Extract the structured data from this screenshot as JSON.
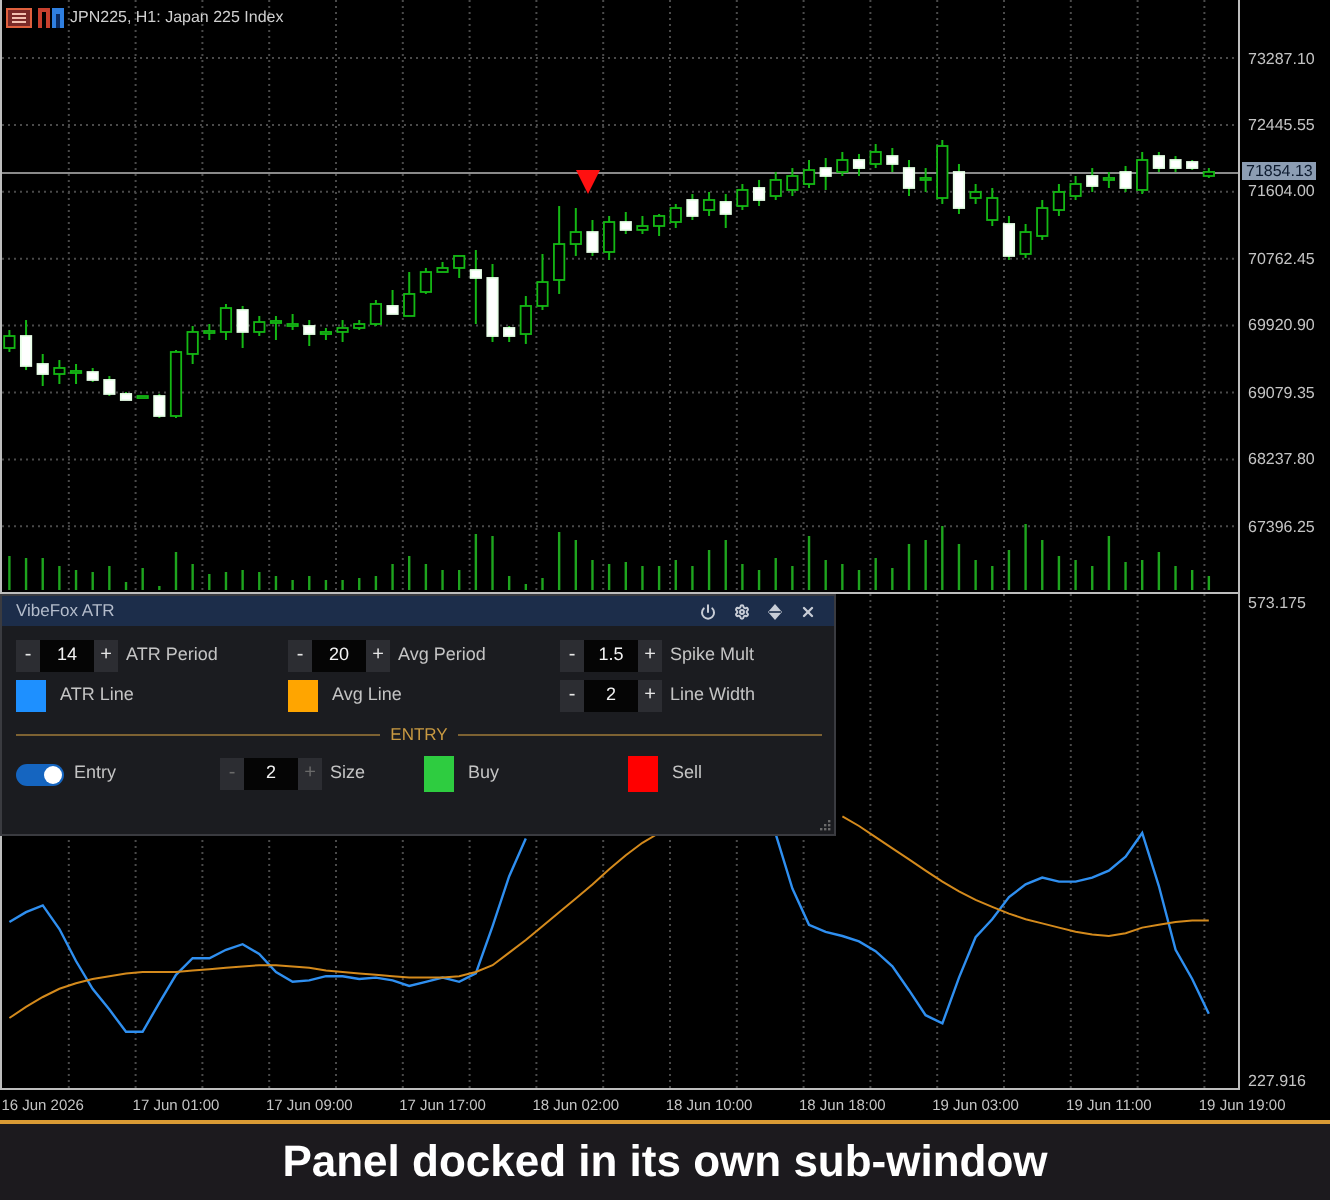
{
  "chart": {
    "title": "JPN225, H1: Japan 225 Index",
    "chart_data": {
      "type": "candlestick",
      "categories": [
        null,
        null,
        null,
        null,
        null,
        null,
        null,
        null,
        null,
        null,
        null,
        null,
        null,
        null,
        null,
        null,
        null,
        null,
        null,
        null,
        null,
        null,
        null,
        null,
        null,
        null,
        null,
        null,
        null,
        null,
        null,
        null,
        null,
        null,
        null,
        null,
        null,
        null,
        null,
        null,
        null,
        null,
        null,
        null,
        null,
        null,
        null,
        null,
        null,
        null,
        null,
        null,
        null,
        null,
        null,
        null,
        null,
        null,
        null,
        null,
        null,
        null,
        null,
        null,
        null,
        null,
        null,
        null,
        null,
        null,
        null,
        null,
        null
      ],
      "ohlc": [
        [
          69639,
          69866,
          69589,
          69790
        ],
        [
          69790,
          69991,
          69362,
          69413
        ],
        [
          69438,
          69564,
          69161,
          69312
        ],
        [
          69312,
          69488,
          69186,
          69388
        ],
        [
          69325,
          69438,
          69186,
          69350
        ],
        [
          69337,
          69388,
          69212,
          69237
        ],
        [
          69237,
          69287,
          69035,
          69061
        ],
        [
          69061,
          69086,
          68985,
          68985
        ],
        [
          69010,
          69035,
          69010,
          69035
        ],
        [
          69035,
          69061,
          68759,
          68784
        ],
        [
          68784,
          69614,
          68759,
          69589
        ],
        [
          69564,
          69916,
          69438,
          69841
        ],
        [
          69828,
          69941,
          69740,
          69853
        ],
        [
          69841,
          70193,
          69740,
          70142
        ],
        [
          70117,
          70168,
          69639,
          69841
        ],
        [
          69841,
          70042,
          69790,
          69966
        ],
        [
          69954,
          70042,
          69740,
          69979
        ],
        [
          69916,
          70067,
          69866,
          69941
        ],
        [
          69916,
          69991,
          69664,
          69815
        ],
        [
          69815,
          69891,
          69740,
          69841
        ],
        [
          69841,
          69991,
          69715,
          69891
        ],
        [
          69891,
          69991,
          69866,
          69941
        ],
        [
          69941,
          70243,
          69916,
          70193
        ],
        [
          70168,
          70369,
          70067,
          70067
        ],
        [
          70042,
          70595,
          70042,
          70319
        ],
        [
          70344,
          70646,
          70319,
          70595
        ],
        [
          70595,
          70721,
          70595,
          70646
        ],
        [
          70646,
          70797,
          70520,
          70797
        ],
        [
          70620,
          70872,
          69941,
          70520
        ],
        [
          70520,
          70696,
          69715,
          69790
        ],
        [
          69891,
          69916,
          69715,
          69790
        ],
        [
          69815,
          70293,
          69690,
          70168
        ],
        [
          70168,
          70822,
          70117,
          70469
        ],
        [
          70495,
          71425,
          70319,
          70947
        ],
        [
          70947,
          71400,
          70797,
          71098
        ],
        [
          71098,
          71249,
          70797,
          70847
        ],
        [
          70847,
          71300,
          70746,
          71224
        ],
        [
          71224,
          71350,
          71073,
          71124
        ],
        [
          71124,
          71300,
          71073,
          71174
        ],
        [
          71174,
          71325,
          71048,
          71300
        ],
        [
          71224,
          71451,
          71149,
          71400
        ],
        [
          71501,
          71576,
          71249,
          71300
        ],
        [
          71375,
          71602,
          71300,
          71501
        ],
        [
          71476,
          71576,
          71149,
          71325
        ],
        [
          71425,
          71702,
          71375,
          71627
        ],
        [
          71652,
          71753,
          71425,
          71501
        ],
        [
          71551,
          71853,
          71501,
          71753
        ],
        [
          71627,
          71903,
          71551,
          71803
        ],
        [
          71702,
          72004,
          71652,
          71878
        ],
        [
          71903,
          72029,
          71627,
          71803
        ],
        [
          71853,
          72105,
          71803,
          72004
        ],
        [
          72004,
          72080,
          71803,
          71903
        ],
        [
          71954,
          72205,
          71903,
          72105
        ],
        [
          72054,
          72155,
          71853,
          71954
        ],
        [
          71903,
          72004,
          71551,
          71652
        ],
        [
          71753,
          71903,
          71602,
          71778
        ],
        [
          71526,
          72256,
          71451,
          72180
        ],
        [
          71853,
          71954,
          71325,
          71400
        ],
        [
          71526,
          71702,
          71451,
          71602
        ],
        [
          71249,
          71652,
          71174,
          71526
        ],
        [
          71199,
          71300,
          70746,
          70797
        ],
        [
          70822,
          71199,
          70771,
          71098
        ],
        [
          71048,
          71501,
          70998,
          71400
        ],
        [
          71375,
          71702,
          71300,
          71602
        ],
        [
          71551,
          71803,
          71501,
          71702
        ],
        [
          71803,
          71903,
          71602,
          71677
        ],
        [
          71753,
          71853,
          71652,
          71778
        ],
        [
          71853,
          71929,
          71602,
          71652
        ],
        [
          71627,
          72105,
          71576,
          72004
        ],
        [
          72054,
          72105,
          71853,
          71903
        ],
        [
          72004,
          72054,
          71853,
          71903
        ],
        [
          71979,
          72004,
          71878,
          71903
        ],
        [
          71803,
          71903,
          71778,
          71854
        ]
      ],
      "ylim": [
        66569.9,
        74016.7
      ],
      "yticks": [
        {
          "value": 73287.1,
          "label": "73287.10"
        },
        {
          "value": 72445.55,
          "label": "72445.55"
        },
        {
          "value": 71604,
          "label": "71604.00"
        },
        {
          "value": 70762.45,
          "label": "70762.45"
        },
        {
          "value": 69920.9,
          "label": "69920.90"
        },
        {
          "value": 69079.35,
          "label": "69079.35"
        },
        {
          "value": 68237.8,
          "label": "68237.80"
        },
        {
          "value": 67396.25,
          "label": "67396.25"
        }
      ],
      "ref_lines": [
        {
          "axis": "y",
          "value": 71854.13,
          "label": "71854.13"
        }
      ],
      "grid": true
    }
  },
  "indicator_window": {
    "chart_data": {
      "type": "line",
      "categories": [
        null,
        null,
        "16 Jun 2026",
        null,
        null,
        null,
        null,
        null,
        null,
        null,
        "17 Jun 01:00",
        null,
        null,
        null,
        null,
        null,
        null,
        null,
        "17 Jun 09:00",
        null,
        null,
        null,
        null,
        null,
        null,
        null,
        "17 Jun 17:00",
        null,
        null,
        null,
        null,
        null,
        null,
        null,
        "18 Jun 02:00",
        null,
        null,
        null,
        null,
        null,
        null,
        null,
        "18 Jun 10:00",
        null,
        null,
        null,
        null,
        null,
        null,
        null,
        "18 Jun 18:00",
        null,
        null,
        null,
        null,
        null,
        null,
        null,
        "19 Jun 03:00",
        null,
        null,
        null,
        null,
        null,
        null,
        null,
        "19 Jun 11:00",
        null,
        null,
        null,
        null,
        null,
        null,
        null,
        "19 Jun 19:00"
      ],
      "series": [
        {
          "color": "#2f8ff0",
          "values": [
            343,
            350,
            355,
            338,
            315,
            295,
            280,
            264,
            264,
            285,
            305,
            317,
            317,
            323,
            327,
            320,
            307,
            300,
            301,
            304,
            304,
            302,
            303,
            301,
            297,
            300,
            303,
            300,
            306,
            340,
            376,
            403,
            null,
            null,
            null,
            null,
            null,
            null,
            null,
            null,
            null,
            null,
            null,
            null,
            null,
            null,
            406,
            367,
            341,
            336,
            333,
            329,
            322,
            311,
            294,
            276,
            270,
            303,
            332,
            345,
            361,
            370,
            375,
            372,
            372,
            375,
            380,
            390,
            407,
            369,
            323,
            302,
            277,
            null,
            null
          ]
        },
        {
          "color": "#d48a1c",
          "values": [
            274,
            282,
            289,
            295,
            299,
            302,
            304,
            306,
            307,
            307,
            307,
            308,
            309,
            310,
            311,
            312,
            312,
            311,
            310,
            308,
            307,
            306,
            305,
            304,
            303,
            303,
            303,
            304,
            307,
            312,
            321,
            330,
            340,
            350,
            360,
            370,
            381,
            391,
            400,
            407,
            null,
            null,
            null,
            null,
            null,
            null,
            null,
            null,
            null,
            null,
            419,
            412,
            404,
            396,
            388,
            380,
            372,
            365,
            359,
            354,
            349,
            345,
            342,
            339,
            336,
            334,
            333,
            335,
            339,
            341,
            343,
            344,
            344,
            null,
            null
          ]
        }
      ],
      "ylim": [
        223.6,
        578.93
      ],
      "yticks": [
        {
          "value": 573.175,
          "label": "573.175"
        },
        {
          "value": 227.916,
          "label": "227.916"
        }
      ],
      "grid": true
    }
  },
  "panel": {
    "title": "VibeFox ATR",
    "settings": [
      [
        {
          "kind": "stepper",
          "decrement": "-",
          "value": "14",
          "increment": "+",
          "label": "ATR Period",
          "dimmed": false
        },
        {
          "kind": "stepper",
          "decrement": "-",
          "value": "20",
          "increment": "+",
          "label": "Avg Period",
          "dimmed": false
        },
        {
          "kind": "stepper",
          "decrement": "-",
          "value": "1.5",
          "increment": "+",
          "label": "Spike Mult",
          "dimmed": false
        }
      ],
      [
        {
          "kind": "color",
          "color": "#1e90ff",
          "name": "ATR Line"
        },
        {
          "kind": "color",
          "color": "#ffa500",
          "name": "Avg Line"
        },
        {
          "kind": "stepper",
          "decrement": "-",
          "value": "2",
          "increment": "+",
          "label": "Line Width",
          "dimmed": false
        }
      ]
    ],
    "section_heading": "ENTRY",
    "entry_controls": [
      {
        "kind": "toggle",
        "on": true,
        "name": "Entry"
      },
      {
        "kind": "stepper",
        "decrement": "-",
        "value": "2",
        "increment": "+",
        "label": "Size",
        "dimmed": true
      },
      {
        "kind": "color",
        "color": "#2ecc40",
        "name": "Buy"
      },
      {
        "kind": "color",
        "color": "#ff0000",
        "name": "Sell"
      }
    ]
  },
  "caption": "Panel docked in its own sub-window"
}
